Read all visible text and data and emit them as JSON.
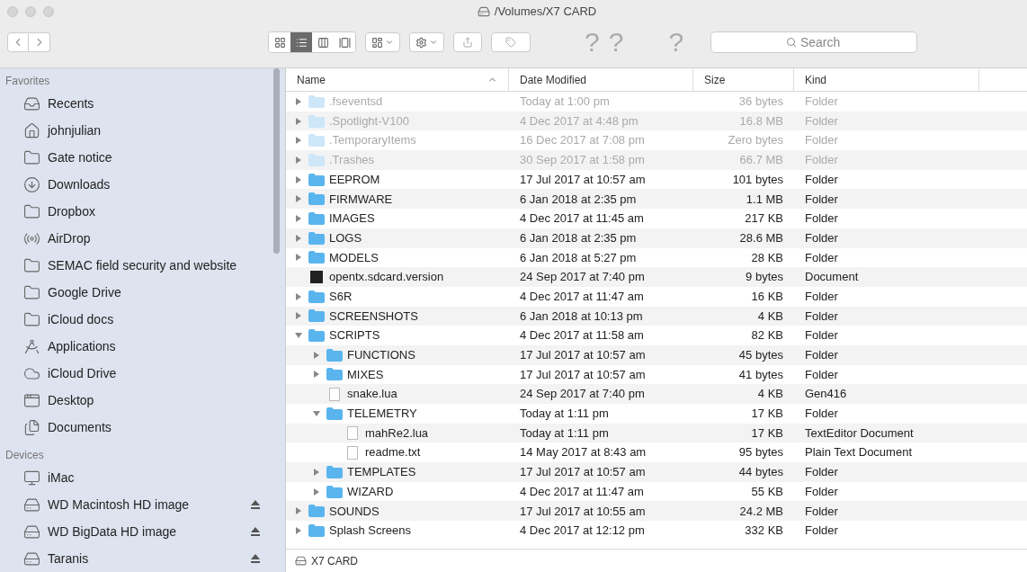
{
  "window": {
    "title": "/Volumes/X7 CARD"
  },
  "toolbar": {
    "views": [
      {
        "kind": "icons",
        "selected": false
      },
      {
        "kind": "list",
        "selected": true
      },
      {
        "kind": "columns",
        "selected": false
      },
      {
        "kind": "coverflow",
        "selected": false
      }
    ],
    "extra_buttons": [
      "?",
      "?",
      "?"
    ],
    "search": {
      "placeholder": "Search"
    }
  },
  "sidebar": {
    "sections": [
      {
        "title": "Favorites",
        "items": [
          {
            "label": "Recents",
            "kind": "recents",
            "ejectable": false
          },
          {
            "label": "johnjulian",
            "kind": "home",
            "ejectable": false
          },
          {
            "label": "Gate notice",
            "kind": "folder",
            "ejectable": false
          },
          {
            "label": "Downloads",
            "kind": "downloads",
            "ejectable": false
          },
          {
            "label": "Dropbox",
            "kind": "folder",
            "ejectable": false
          },
          {
            "label": "AirDrop",
            "kind": "airdrop",
            "ejectable": false
          },
          {
            "label": "SEMAC field security and website",
            "kind": "folder",
            "ejectable": false
          },
          {
            "label": "Google Drive",
            "kind": "folder",
            "ejectable": false
          },
          {
            "label": "iCloud docs",
            "kind": "folder",
            "ejectable": false
          },
          {
            "label": "Applications",
            "kind": "applications",
            "ejectable": false
          },
          {
            "label": "iCloud Drive",
            "kind": "cloud",
            "ejectable": false
          },
          {
            "label": "Desktop",
            "kind": "desktop",
            "ejectable": false
          },
          {
            "label": "Documents",
            "kind": "documents",
            "ejectable": false
          }
        ]
      },
      {
        "title": "Devices",
        "items": [
          {
            "label": "iMac",
            "kind": "computer",
            "ejectable": false
          },
          {
            "label": "WD Macintosh HD image",
            "kind": "disk",
            "ejectable": true
          },
          {
            "label": "WD BigData HD image",
            "kind": "disk",
            "ejectable": true
          },
          {
            "label": "Taranis",
            "kind": "disk",
            "ejectable": true
          }
        ]
      }
    ]
  },
  "table": {
    "columns": [
      {
        "label": "Name",
        "sorted": true
      },
      {
        "label": "Date Modified",
        "sorted": false
      },
      {
        "label": "Size",
        "sorted": false
      },
      {
        "label": "Kind",
        "sorted": false
      }
    ],
    "rows": [
      {
        "name": ".fseventsd",
        "date": "Today at 1:00 pm",
        "size": "36 bytes",
        "file_kind": "Folder",
        "kind": "folder",
        "hidden": true,
        "expanded": false
      },
      {
        "name": ".Spotlight-V100",
        "date": "4 Dec 2017 at 4:48 pm",
        "size": "16.8 MB",
        "file_kind": "Folder",
        "kind": "folder",
        "hidden": true,
        "expanded": false
      },
      {
        "name": ".TemporaryItems",
        "date": "16 Dec 2017 at 7:08 pm",
        "size": "Zero bytes",
        "file_kind": "Folder",
        "kind": "folder",
        "hidden": true,
        "expanded": false
      },
      {
        "name": ".Trashes",
        "date": "30 Sep 2017 at 1:58 pm",
        "size": "66.7 MB",
        "file_kind": "Folder",
        "kind": "folder",
        "hidden": true,
        "expanded": false
      },
      {
        "name": "EEPROM",
        "date": "17 Jul 2017 at 10:57 am",
        "size": "101 bytes",
        "file_kind": "Folder",
        "kind": "folder",
        "hidden": false,
        "expanded": false
      },
      {
        "name": "FIRMWARE",
        "date": "6 Jan 2018 at 2:35 pm",
        "size": "1.1 MB",
        "file_kind": "Folder",
        "kind": "folder",
        "hidden": false,
        "expanded": false
      },
      {
        "name": "IMAGES",
        "date": "4 Dec 2017 at 11:45 am",
        "size": "217 KB",
        "file_kind": "Folder",
        "kind": "folder",
        "hidden": false,
        "expanded": false
      },
      {
        "name": "LOGS",
        "date": "6 Jan 2018 at 2:35 pm",
        "size": "28.6 MB",
        "file_kind": "Folder",
        "kind": "folder",
        "hidden": false,
        "expanded": false
      },
      {
        "name": "MODELS",
        "date": "6 Jan 2018 at 5:27 pm",
        "size": "28 KB",
        "file_kind": "Folder",
        "kind": "folder",
        "hidden": false,
        "expanded": false
      },
      {
        "name": "opentx.sdcard.version",
        "date": "24 Sep 2017 at 7:40 pm",
        "size": "9 bytes",
        "file_kind": "Document",
        "kind": "binary",
        "hidden": false
      },
      {
        "name": "S6R",
        "date": "4 Dec 2017 at 11:47 am",
        "size": "16 KB",
        "file_kind": "Folder",
        "kind": "folder",
        "hidden": false,
        "expanded": false
      },
      {
        "name": "SCREENSHOTS",
        "date": "6 Jan 2018 at 10:13 pm",
        "size": "4 KB",
        "file_kind": "Folder",
        "kind": "folder",
        "hidden": false,
        "expanded": false
      },
      {
        "name": "SCRIPTS",
        "date": "4 Dec 2017 at 11:58 am",
        "size": "82 KB",
        "file_kind": "Folder",
        "kind": "folder",
        "hidden": false,
        "expanded": true,
        "children": [
          {
            "name": "FUNCTIONS",
            "date": "17 Jul 2017 at 10:57 am",
            "size": "45 bytes",
            "file_kind": "Folder",
            "kind": "folder",
            "hidden": false,
            "expanded": false
          },
          {
            "name": "MIXES",
            "date": "17 Jul 2017 at 10:57 am",
            "size": "41 bytes",
            "file_kind": "Folder",
            "kind": "folder",
            "hidden": false,
            "expanded": false
          },
          {
            "name": "snake.lua",
            "date": "24 Sep 2017 at 7:40 pm",
            "size": "4 KB",
            "file_kind": "Gen416",
            "kind": "file",
            "hidden": false
          },
          {
            "name": "TELEMETRY",
            "date": "Today at 1:11 pm",
            "size": "17 KB",
            "file_kind": "Folder",
            "kind": "folder",
            "hidden": false,
            "expanded": true,
            "children": [
              {
                "name": "mahRe2.lua",
                "date": "Today at 1:11 pm",
                "size": "17 KB",
                "file_kind": "TextEditor Document",
                "kind": "file",
                "hidden": false
              },
              {
                "name": "readme.txt",
                "date": "14 May 2017 at 8:43 am",
                "size": "95 bytes",
                "file_kind": "Plain Text Document",
                "kind": "file",
                "hidden": false
              }
            ]
          },
          {
            "name": "TEMPLATES",
            "date": "17 Jul 2017 at 10:57 am",
            "size": "44 bytes",
            "file_kind": "Folder",
            "kind": "folder",
            "hidden": false,
            "expanded": false
          },
          {
            "name": "WIZARD",
            "date": "4 Dec 2017 at 11:47 am",
            "size": "55 KB",
            "file_kind": "Folder",
            "kind": "folder",
            "hidden": false,
            "expanded": false
          }
        ]
      },
      {
        "name": "SOUNDS",
        "date": "17 Jul 2017 at 10:55 am",
        "size": "24.2 MB",
        "file_kind": "Folder",
        "kind": "folder",
        "hidden": false,
        "expanded": false
      },
      {
        "name": "Splash Screens",
        "date": "4 Dec 2017 at 12:12 pm",
        "size": "332 KB",
        "file_kind": "Folder",
        "kind": "folder",
        "hidden": false,
        "expanded": false
      }
    ]
  },
  "path_bar": {
    "label": "X7 CARD"
  }
}
